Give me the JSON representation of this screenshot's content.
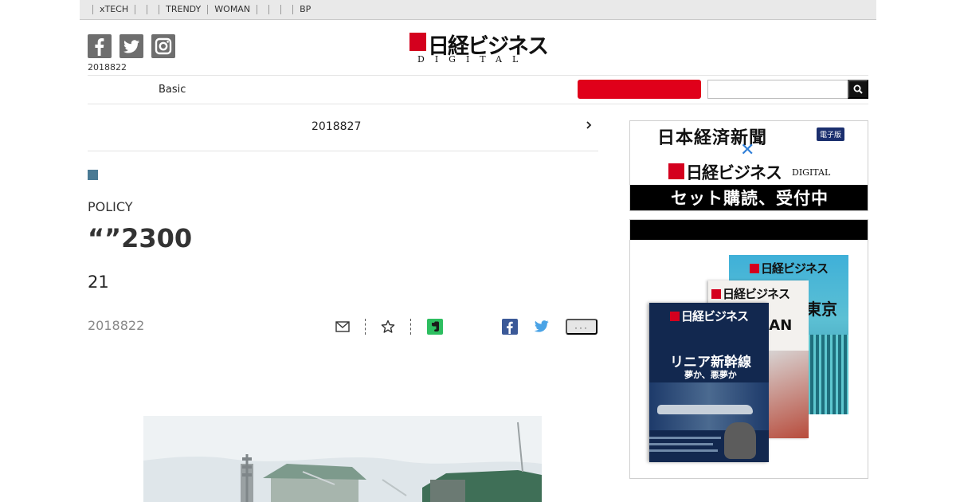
{
  "topnav": {
    "items": [
      {
        "label": "xTECH"
      },
      {
        "label": ""
      },
      {
        "label": ""
      },
      {
        "label": "TRENDY"
      },
      {
        "label": "WOMAN"
      },
      {
        "label": ""
      },
      {
        "label": ""
      },
      {
        "label": ""
      },
      {
        "label": "BP"
      }
    ]
  },
  "header": {
    "date": "2018822",
    "logo": {
      "text": "日経ビジネス",
      "sub": "DIGITAL"
    },
    "social": [
      "facebook-icon",
      "twitter-icon",
      "instagram-icon"
    ]
  },
  "nav": {
    "basic_label": "Basic",
    "red_button_label": "",
    "search_placeholder": ""
  },
  "article": {
    "series_date": "2018827",
    "kicker": "POLICY",
    "title": "“”2300",
    "subtitle": "21",
    "date": "2018822",
    "tools": [
      "mail-icon",
      "star-icon",
      "evernote-icon",
      "facebook-icon",
      "twitter-icon"
    ],
    "more_label": "···"
  },
  "sidebar": {
    "ad1": {
      "line1": "日本経済新聞",
      "badge": "電子版",
      "cross": "✕",
      "logo": "日経ビジネス",
      "logo_sub": "DIGITAL",
      "band": "セット購読、受付中"
    },
    "ad2": {
      "mag_logo": "日経ビジネス",
      "cover_front_headline": "リニア新幹線",
      "cover_front_sub": "夢か、悪夢か",
      "cover_mid_text": "EAN",
      "cover_back_text": "東京"
    }
  },
  "colors": {
    "brand_red": "#d4001e",
    "search_button_red": "#e0001a",
    "tag_blue": "#4a7a94",
    "facebook_blue": "#3b5998",
    "twitter_blue": "#1da1f2",
    "evernote_green": "#2dbe60"
  }
}
